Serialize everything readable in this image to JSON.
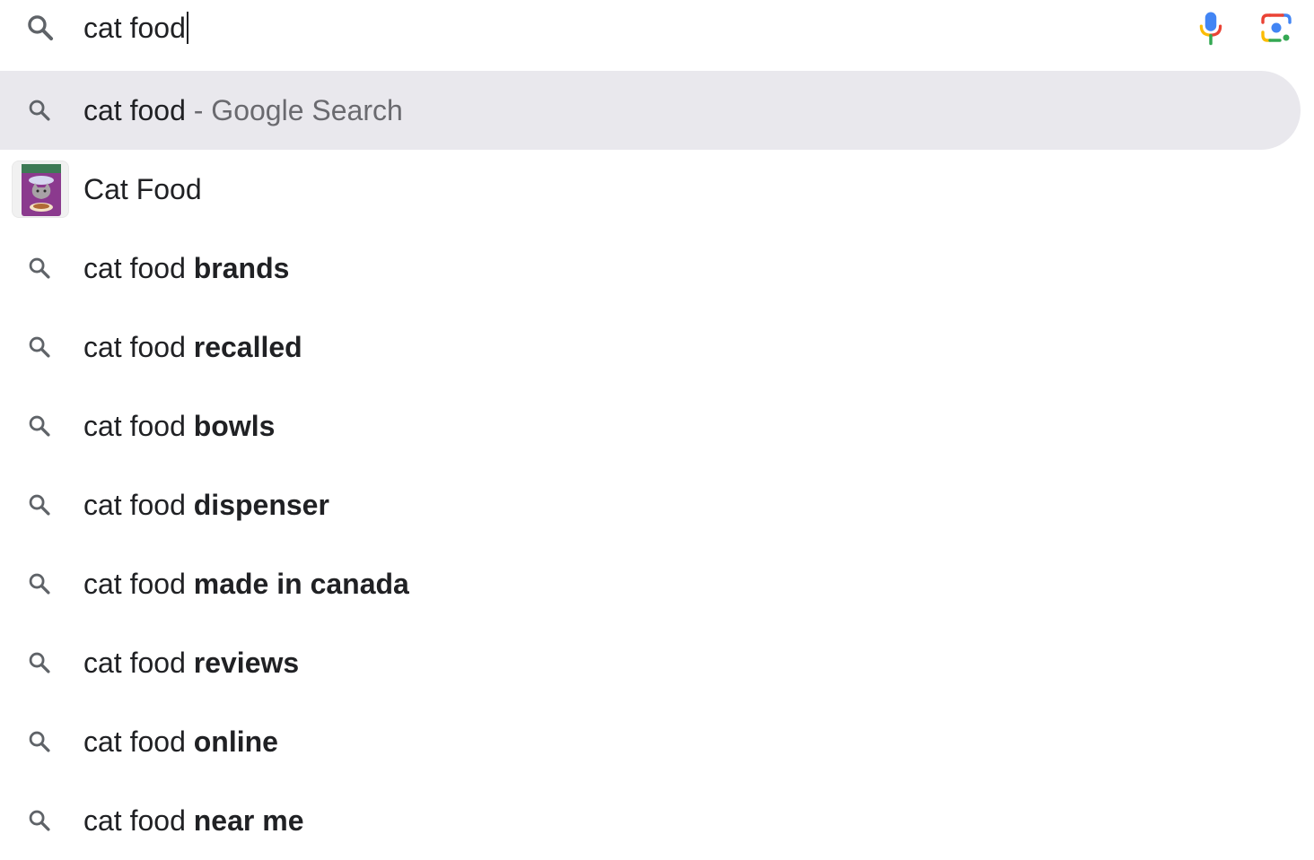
{
  "search": {
    "query": "cat food",
    "icons": [
      "search-icon",
      "mic-icon",
      "lens-icon"
    ]
  },
  "suggestions": [
    {
      "type": "search",
      "prefix": "cat food",
      "suffix": " - Google Search",
      "highlighted": true,
      "icon": "search-icon"
    },
    {
      "type": "entity",
      "label": "Cat Food",
      "icon": "product-thumbnail"
    },
    {
      "type": "search",
      "prefix": "cat food",
      "completion": " brands",
      "icon": "search-icon"
    },
    {
      "type": "search",
      "prefix": "cat food",
      "completion": " recalled",
      "icon": "search-icon"
    },
    {
      "type": "search",
      "prefix": "cat food",
      "completion": " bowls",
      "icon": "search-icon"
    },
    {
      "type": "search",
      "prefix": "cat food",
      "completion": " dispenser",
      "icon": "search-icon"
    },
    {
      "type": "search",
      "prefix": "cat food",
      "completion": " made in canada",
      "icon": "search-icon"
    },
    {
      "type": "search",
      "prefix": "cat food",
      "completion": " reviews",
      "icon": "search-icon"
    },
    {
      "type": "search",
      "prefix": "cat food",
      "completion": " online",
      "icon": "search-icon"
    },
    {
      "type": "search",
      "prefix": "cat food",
      "completion": " near me",
      "icon": "search-icon"
    }
  ],
  "colors": {
    "highlight_bg": "#e9e8ed",
    "text": "#202124",
    "muted": "#6a6a6f",
    "google_blue": "#4285f4",
    "google_red": "#ea4335",
    "google_yellow": "#fbbc04",
    "google_green": "#34a853"
  }
}
